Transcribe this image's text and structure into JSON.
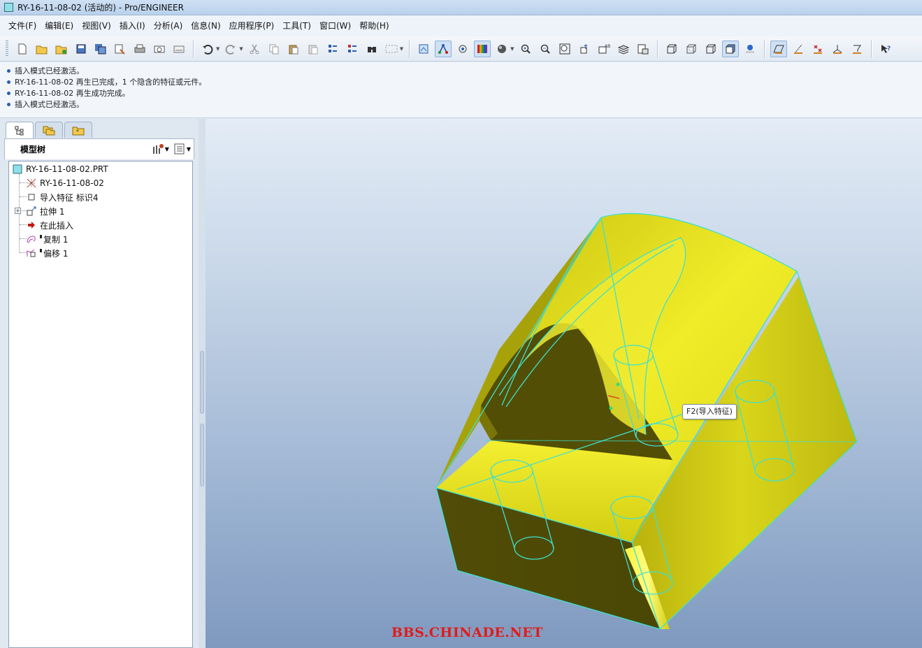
{
  "window": {
    "title": "RY-16-11-08-02 (活动的) - Pro/ENGINEER"
  },
  "menu": [
    "文件(F)",
    "编辑(E)",
    "视图(V)",
    "插入(I)",
    "分析(A)",
    "信息(N)",
    "应用程序(P)",
    "工具(T)",
    "窗口(W)",
    "帮助(H)"
  ],
  "toolbar": {
    "icons": [
      "new-icon",
      "open-icon",
      "set-working-dir-icon",
      "save-icon",
      "save-copy-icon",
      "backup-icon",
      "print-icon",
      "send-mail-icon",
      "send-link-icon",
      "undo-icon",
      "redo-icon",
      "cut-icon",
      "copy-icon",
      "paste-icon",
      "paste-special-icon",
      "regenerate-icon",
      "regen-manager-icon",
      "find-icon",
      "select-box-icon",
      "repaint-icon",
      "spin-center-icon",
      "orient-mode-icon",
      "appearance-icon",
      "sphere-icon",
      "zoom-in-icon",
      "zoom-out-icon",
      "refit-icon",
      "reorient-icon",
      "saved-views-icon",
      "layers-icon",
      "view-manager-icon",
      "wireframe-icon",
      "hidden-line-icon",
      "no-hidden-icon",
      "shading-icon",
      "enhanced-realism-icon",
      "datum-planes-icon",
      "datum-axes-icon",
      "datum-points-icon",
      "coordinate-systems-icon",
      "annotations-icon",
      "context-help-icon"
    ]
  },
  "messages": [
    "插入模式已经激活。",
    "RY-16-11-08-02 再生已完成，1 个隐含的特征或元件。",
    "RY-16-11-08-02 再生成功完成。",
    "插入模式已经激活。"
  ],
  "model_tree": {
    "title": "模型树",
    "items": [
      {
        "label": "RY-16-11-08-02.PRT",
        "icon": "part-icon"
      },
      {
        "label": "RY-16-11-08-02",
        "icon": "coordinate-icon"
      },
      {
        "label": "导入特征 标识4",
        "icon": "import-feature-icon"
      },
      {
        "label": "拉伸 1",
        "icon": "extrude-icon"
      },
      {
        "label": "在此插入",
        "icon": "insert-here-arrow-icon"
      },
      {
        "label": "复制 1",
        "icon": "copy-feature-icon"
      },
      {
        "label": "偏移 1",
        "icon": "offset-feature-icon"
      }
    ]
  },
  "viewport": {
    "tooltip": "F2(导入特征)",
    "watermark": "BBS.CHINADE.NET"
  },
  "colors": {
    "model_face_light": "#e6e61a",
    "model_face_dark": "#4f4c06",
    "edge_highlight": "#3fe0d0",
    "watermark": "#e11b1b"
  }
}
